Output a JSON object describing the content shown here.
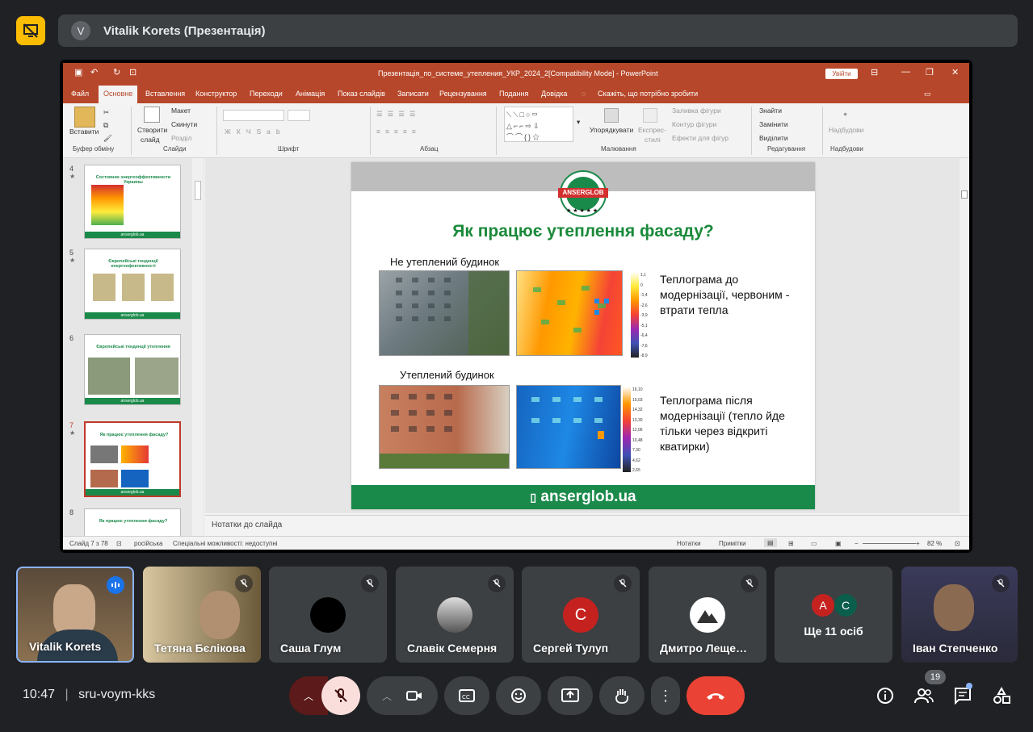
{
  "presenter": {
    "avatar_letter": "V",
    "name": "Vitalik Korets (Презентація)"
  },
  "ppt": {
    "window_title": "Презентація_по_системе_утепления_УКР_2024_2[Compatibility Mode]  -  PowerPoint",
    "sign_in": "Увійти",
    "tabs": [
      "Файл",
      "Основне",
      "Вставлення",
      "Конструктор",
      "Переходи",
      "Анімація",
      "Показ слайдів",
      "Записати",
      "Рецензування",
      "Подання",
      "Довідка"
    ],
    "active_tab": "Основне",
    "tell_me": "Скажіть, що потрібно зробити",
    "ribbon": {
      "paste": "Вставити",
      "clipboard": "Буфер обміну",
      "new_slide": "Створити",
      "new_slide2": "слайд",
      "layout": "Макет",
      "reset": "Скинути",
      "section": "Розділ",
      "slides": "Слайди",
      "font": "Шрифт",
      "paragraph": "Абзац",
      "arrange": "Упорядкувати",
      "quick_styles": "Експрес-",
      "quick_styles2": "стилі",
      "shape_fill": "Заливка фігури",
      "shape_outline": "Контур фігури",
      "shape_effects": "Ефекти для фігур",
      "drawing": "Малювання",
      "find": "Знайти",
      "replace": "Замінити",
      "select": "Виділити",
      "editing": "Редагування",
      "addins": "Надбудови",
      "addins_group": "Надбудови"
    },
    "thumbnails": [
      {
        "num": "4",
        "title": "Состояние энергоэффективности Украины"
      },
      {
        "num": "5",
        "title": "Європейські тенденції енергоефективності"
      },
      {
        "num": "6",
        "title": "Європейські тенденції утеплення"
      },
      {
        "num": "7",
        "title": "Як працює утеплення фасаду?"
      },
      {
        "num": "8",
        "title": "Як працює утеплення фасаду?"
      }
    ],
    "thumb_footer": "anserglob.ua",
    "slide": {
      "logo": "ANSERGLOB",
      "stars": "★ ★ ★ ★ ★",
      "title": "Як працює утеплення фасаду?",
      "label_before": "Не утеплений будинок",
      "label_after": "Утеплений будинок",
      "desc_before": "Теплограма до модернізації, червоним - втрати тепла",
      "desc_after": "Теплограма після модернізації (тепло йде тільки через відкриті кватирки)",
      "footer": "anserglob.ua",
      "scale_top": [
        "1,1",
        "0",
        "-1,4",
        "-2,6",
        "-3,9",
        "-5,1",
        "-6,4",
        "-7,6",
        "-8,9"
      ],
      "scale_bottom": [
        "16,10",
        "15,03",
        "14,32",
        "13,30",
        "12,06",
        "10,48",
        "7,30",
        "4,62",
        "2,65"
      ]
    },
    "notes_placeholder": "Нотатки до слайда",
    "status": {
      "slide_of": "Слайд 7 з 78",
      "language": "російська",
      "accessibility": "Спеціальні можливості: недоступні",
      "notes": "Нотатки",
      "comments": "Примітки",
      "zoom": "82 %"
    }
  },
  "participants": [
    {
      "name": "Vitalik Korets"
    },
    {
      "name": "Тетяна Бєлікова"
    },
    {
      "name": "Саша Глум"
    },
    {
      "name": "Славік Семерня"
    },
    {
      "name": "Сергей Тулуп",
      "avatar": "С",
      "color": "#c5221f"
    },
    {
      "name": "Дмитро Леще…"
    },
    {
      "name": "Ще 11 осіб",
      "avatars": [
        "А",
        "С"
      ]
    },
    {
      "name": "Іван Степченко"
    }
  ],
  "meeting": {
    "time": "10:47",
    "code": "sru-voym-kks",
    "participant_count": "19"
  },
  "colors": {
    "accent_yellow": "#fbbc04",
    "end_call": "#ea4335",
    "ppt_red": "#b7472a",
    "slide_green": "#1a8a4a"
  }
}
